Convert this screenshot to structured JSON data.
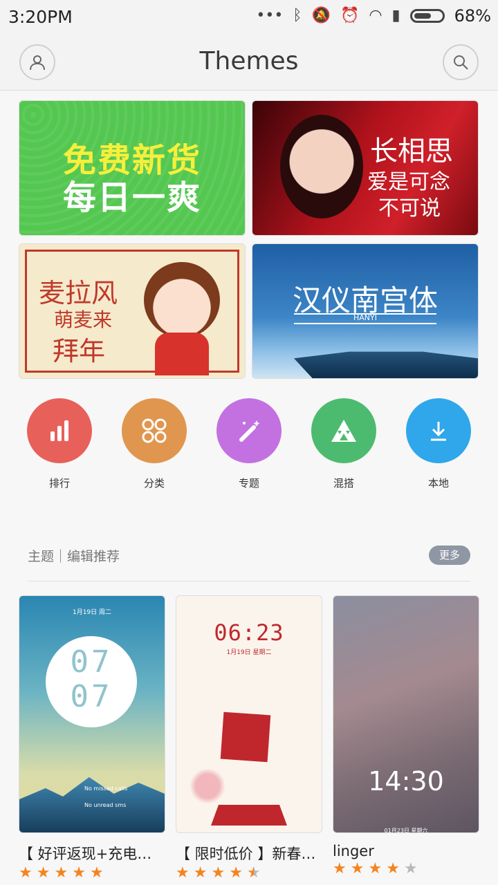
{
  "status_bar": {
    "time": "3:20PM",
    "battery_percent": "68%",
    "battery_level": 0.68,
    "icons": [
      "more-dots-icon",
      "bluetooth-icon",
      "mute-icon",
      "alarm-icon",
      "wifi-icon",
      "signal-icon",
      "battery-icon"
    ]
  },
  "header": {
    "title": "Themes",
    "left_icon": "profile-icon",
    "right_icon": "search-icon"
  },
  "banners": [
    {
      "line1": "免费新货",
      "line2": "每日一爽",
      "color": "#54c751"
    },
    {
      "line1": "长相思",
      "line2": "爱是可念",
      "line3": "不可说"
    },
    {
      "line1": "麦拉风",
      "line2": "萌麦来",
      "line3": "拜年"
    },
    {
      "line1": "汉仪南宫体",
      "line2": "HANYI"
    }
  ],
  "categories": [
    {
      "label": "排行",
      "icon": "bar-chart-icon",
      "color": "#e8605a"
    },
    {
      "label": "分类",
      "icon": "grid-icon",
      "color": "#e0964e"
    },
    {
      "label": "专题",
      "icon": "magic-wand-icon",
      "color": "#c371e0"
    },
    {
      "label": "混搭",
      "icon": "triangle-icon",
      "color": "#4dbb6f"
    },
    {
      "label": "本地",
      "icon": "download-icon",
      "color": "#2fa7ea"
    }
  ],
  "section": {
    "title": "主题｜编辑推荐",
    "more_label": "更多"
  },
  "themes": [
    {
      "title": "【 好评返现+充电动…",
      "rating": 5,
      "date": "1月19日 周二",
      "clock_h": "07",
      "clock_m": "07",
      "note1": "No missed calls",
      "note2": "No unread sms"
    },
    {
      "title": "【 限时低价 】新春…",
      "rating": 4.5,
      "date": "1月19日  星期二",
      "clock": "06:23"
    },
    {
      "title": "linger",
      "rating": 4,
      "clock": "14:30",
      "date": "01月23日 星期六"
    }
  ]
}
